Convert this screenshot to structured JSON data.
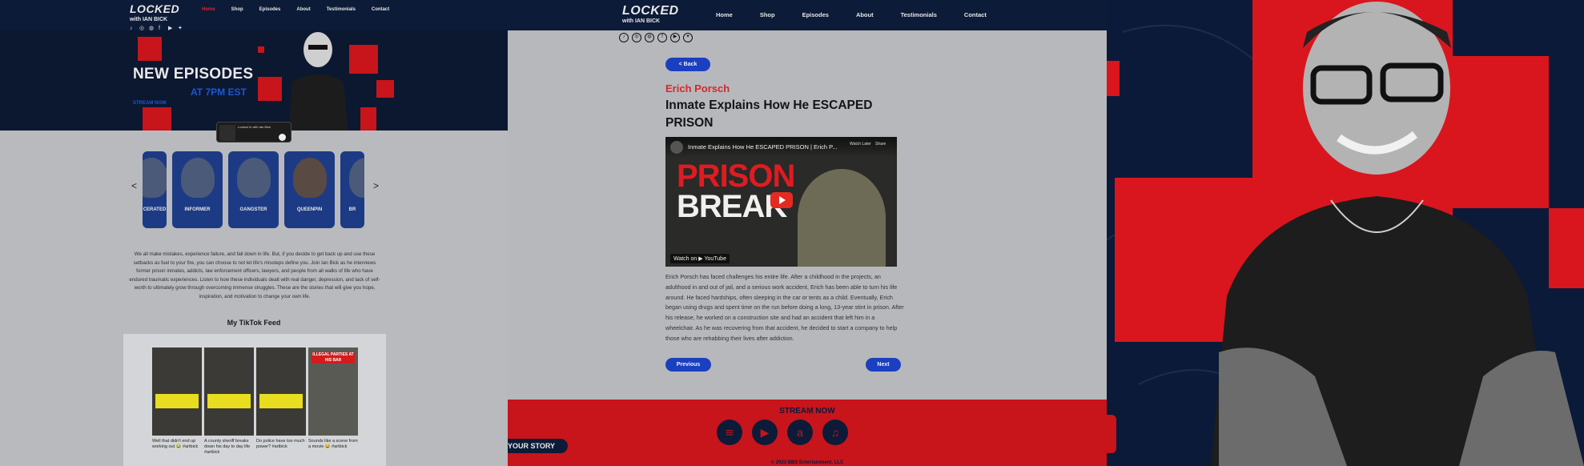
{
  "site": {
    "logo_big": "LOCKED",
    "logo_small": "with IAN BICK"
  },
  "left_panel": {
    "nav": [
      "Home",
      "Shop",
      "Episodes",
      "About",
      "Testimonials",
      "Contact"
    ],
    "nav_active": "Home",
    "hero": {
      "headline": "NEW EPISODES",
      "time": "AT 7PM EST",
      "stream_label": "STREAM NOW"
    },
    "mini_player": {
      "title": "Locked In with Ian Bick"
    },
    "carousel": {
      "prev": "<",
      "next": ">",
      "cards": [
        {
          "label": "CERATED"
        },
        {
          "label": "INFORMER"
        },
        {
          "label": "GANGSTER"
        },
        {
          "label": "QUEENPIN"
        },
        {
          "label": "BR"
        }
      ]
    },
    "intro_text": "We all make mistakes, experience failure, and fall down in life. But, if you decide to get back up and use these setbacks as fuel to your fire, you can choose to not let life's missteps define you. Join Ian Bick as he interviews former prison inmates, addicts, law enforcement officers, lawyers, and people from all walks of life who have endured traumatic experiences. Listen to how these individuals dealt with real danger, depression, and lack of self-worth to ultimately grow through overcoming immense struggles. These are the stories that will give you hope, inspiration, and motivation to change your own life.",
    "tiktok": {
      "title": "My TikTok Feed",
      "items": [
        {
          "caption": "Well that didn't end up working out 😂 #artbick",
          "tag": "#artbick"
        },
        {
          "caption": "A county sheriff breaks down his day to day life #artbick",
          "tag": "#artbick"
        },
        {
          "caption": "Do police have too much power? #artbick",
          "tag": "#artbick"
        },
        {
          "caption": "Sounds like a scene from a movie 😂 #artbick",
          "tag": "#artbick"
        }
      ],
      "banner_4": "ILLEGAL PARTIES AT HIS BAR"
    }
  },
  "middle_panel": {
    "nav": [
      "Home",
      "Shop",
      "Episodes",
      "About",
      "Testimonials",
      "Contact"
    ],
    "back_label": "< Back",
    "guest_name": "Erich Porsch",
    "episode_title": "Inmate Explains How He ESCAPED PRISON",
    "video": {
      "title": "Inmate Explains How He ESCAPED PRISON | Erich P...",
      "thumb_line1": "PRISON",
      "thumb_line2": "BREAK",
      "watch_on": "Watch on ▶ YouTube",
      "watch_later": "Watch Later",
      "share": "Share"
    },
    "bio": "Erich Porsch has faced challenges his entire life. After a childhood in the projects, an adulthood in and out of jail, and a serious work accident, Erich has been able to turn his life around. He faced hardships, often sleeping in the car or tents as a child. Eventually, Erich began using drugs and spent time on the run before doing a long, 13-year stint in prison. After his release, he worked on a construction site and had an accident that left him in a wheelchair. As he was recovering from that accident, he decided to start a company to help those who are rehabbing their lives after addiction.",
    "previous_label": "Previous",
    "next_label": "Next",
    "footer": {
      "stream_now": "STREAM NOW",
      "your_story": "YOUR STORY",
      "platforms": [
        "spotify-icon",
        "youtube-icon",
        "amazon-icon",
        "apple-music-icon"
      ],
      "copyright": "© 2023 BBS Entertainment, LLC"
    }
  },
  "colors": {
    "navy": "#0c1b38",
    "red": "#c8141b",
    "blue_button": "#1a3fc0",
    "page_gray": "#b7b8bb"
  }
}
